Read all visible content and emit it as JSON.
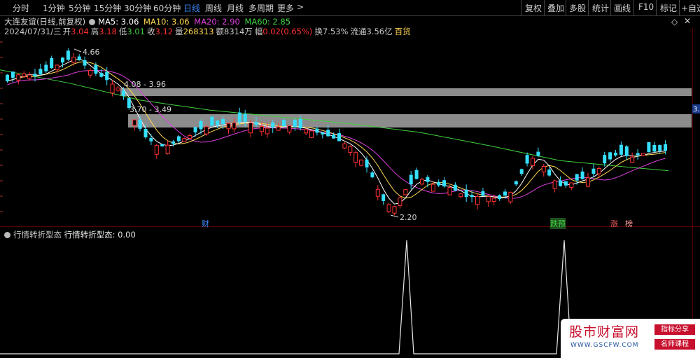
{
  "toolbar": {
    "periods": [
      "分时",
      "1分钟",
      "5分钟",
      "15分钟",
      "30分钟",
      "60分钟",
      "日线",
      "周线",
      "月线",
      "多周期",
      "更多"
    ],
    "active_period": "日线",
    "more_arrow": ">",
    "right_buttons": [
      "复权",
      "叠加",
      "多股",
      "统计",
      "画线",
      "F10",
      "标记",
      "+自选"
    ]
  },
  "header": {
    "title": "大连友谊(日线,前复权)",
    "ma5": "MA5: 3.06",
    "ma10": "MA10: 3.06",
    "ma20": "MA20: 2.90",
    "ma60": "MA60: 2.85",
    "date": "2024/07/31/三",
    "open_label": "开",
    "open": "3.04",
    "high_label": "高",
    "high": "3.18",
    "low_label": "低",
    "low": "3.01",
    "close_label": "收",
    "close": "3.12",
    "vol_label": "量",
    "vol": "268313",
    "amount_label": "额",
    "amount": "8314万",
    "change_label": "幅",
    "change": "0.02(0.65%)",
    "turnover": "换7.53%",
    "float": "流通3.56亿",
    "sector": "百货"
  },
  "annotations": {
    "peak": "4.66",
    "low": "2.20",
    "band1": "4.08 - 3.96",
    "band2": "3.70 - 3.49",
    "price_tag": "3.",
    "sig_cai": "财",
    "sig_dieyu": "跌预",
    "sig_zhang": "涨",
    "sig_bang": "榜"
  },
  "sub_chart": {
    "indicator": "行情转折型态",
    "value_label": "行情转折型态: 0.00"
  },
  "watermark": {
    "name": "股市财富网",
    "url": "WWW.GSCFW.COM",
    "tag1": "指标分享",
    "tag2": "名师课程"
  },
  "colors": {
    "up": "#ff3232",
    "down": "#36e0ff",
    "ma5": "#ffffff",
    "ma10": "#ffd850",
    "ma20": "#e040e0",
    "ma60": "#40d040",
    "active": "#3c8cff"
  }
}
